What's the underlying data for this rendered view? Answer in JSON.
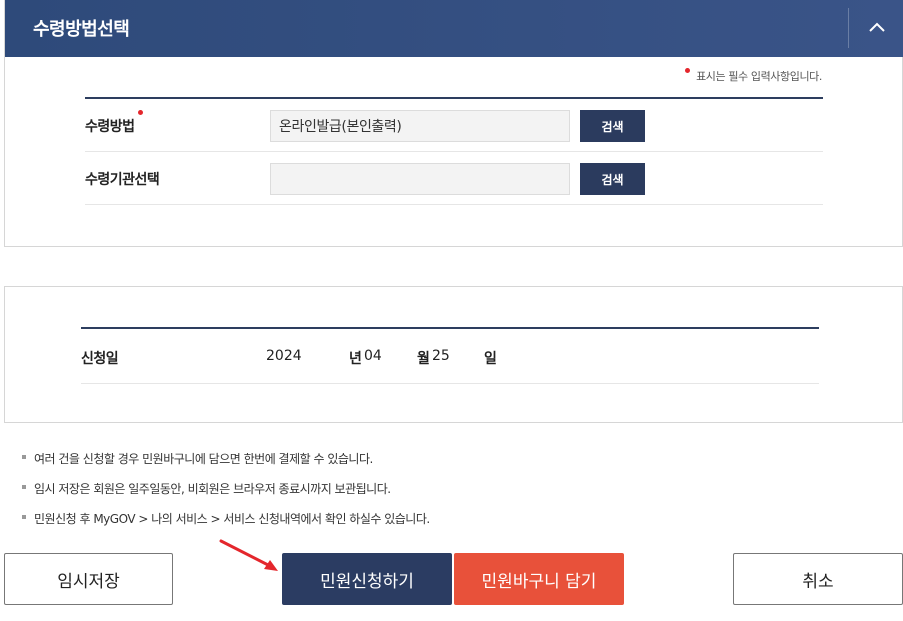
{
  "section1": {
    "title": "수령방법선택",
    "required_note": "표시는 필수 입력사항입니다.",
    "rows": [
      {
        "label": "수령방법",
        "required": true,
        "value": "온라인발급(본인출력)",
        "button": "검색"
      },
      {
        "label": "수령기관선택",
        "required": false,
        "value": "",
        "button": "검색"
      }
    ]
  },
  "section2": {
    "label": "신청일",
    "year": "2024",
    "year_unit": "년",
    "month": "04",
    "month_unit": "월",
    "day": "25",
    "day_unit": "일"
  },
  "notes": [
    "여러 건을 신청할 경우 민원바구니에 담으면 한번에 결제할 수 있습니다.",
    "임시 저장은 회원은 일주일동안, 비회원은 브라우저 종료시까지 보관됩니다.",
    "민원신청 후 MyGOV > 나의 서비스 > 서비스 신청내역에서 확인 하실수 있습니다."
  ],
  "buttons": {
    "temp_save": "임시저장",
    "apply": "민원신청하기",
    "basket": "민원바구니 담기",
    "cancel": "취소"
  },
  "colors": {
    "header": "#2e4a7a",
    "primary": "#2b3c62",
    "accent": "#e8513a",
    "required_dot": "#e4262c",
    "annotation_arrow": "#e4262c"
  }
}
